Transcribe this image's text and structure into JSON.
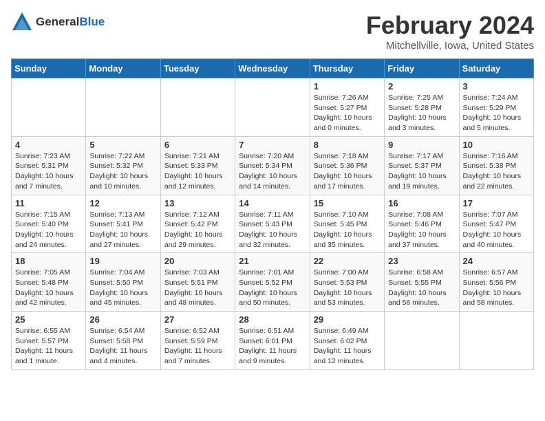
{
  "header": {
    "logo_general": "General",
    "logo_blue": "Blue",
    "month_year": "February 2024",
    "location": "Mitchellville, Iowa, United States"
  },
  "weekdays": [
    "Sunday",
    "Monday",
    "Tuesday",
    "Wednesday",
    "Thursday",
    "Friday",
    "Saturday"
  ],
  "weeks": [
    [
      {
        "day": "",
        "info": ""
      },
      {
        "day": "",
        "info": ""
      },
      {
        "day": "",
        "info": ""
      },
      {
        "day": "",
        "info": ""
      },
      {
        "day": "1",
        "info": "Sunrise: 7:26 AM\nSunset: 5:27 PM\nDaylight: 10 hours\nand 0 minutes."
      },
      {
        "day": "2",
        "info": "Sunrise: 7:25 AM\nSunset: 5:28 PM\nDaylight: 10 hours\nand 3 minutes."
      },
      {
        "day": "3",
        "info": "Sunrise: 7:24 AM\nSunset: 5:29 PM\nDaylight: 10 hours\nand 5 minutes."
      }
    ],
    [
      {
        "day": "4",
        "info": "Sunrise: 7:23 AM\nSunset: 5:31 PM\nDaylight: 10 hours\nand 7 minutes."
      },
      {
        "day": "5",
        "info": "Sunrise: 7:22 AM\nSunset: 5:32 PM\nDaylight: 10 hours\nand 10 minutes."
      },
      {
        "day": "6",
        "info": "Sunrise: 7:21 AM\nSunset: 5:33 PM\nDaylight: 10 hours\nand 12 minutes."
      },
      {
        "day": "7",
        "info": "Sunrise: 7:20 AM\nSunset: 5:34 PM\nDaylight: 10 hours\nand 14 minutes."
      },
      {
        "day": "8",
        "info": "Sunrise: 7:18 AM\nSunset: 5:36 PM\nDaylight: 10 hours\nand 17 minutes."
      },
      {
        "day": "9",
        "info": "Sunrise: 7:17 AM\nSunset: 5:37 PM\nDaylight: 10 hours\nand 19 minutes."
      },
      {
        "day": "10",
        "info": "Sunrise: 7:16 AM\nSunset: 5:38 PM\nDaylight: 10 hours\nand 22 minutes."
      }
    ],
    [
      {
        "day": "11",
        "info": "Sunrise: 7:15 AM\nSunset: 5:40 PM\nDaylight: 10 hours\nand 24 minutes."
      },
      {
        "day": "12",
        "info": "Sunrise: 7:13 AM\nSunset: 5:41 PM\nDaylight: 10 hours\nand 27 minutes."
      },
      {
        "day": "13",
        "info": "Sunrise: 7:12 AM\nSunset: 5:42 PM\nDaylight: 10 hours\nand 29 minutes."
      },
      {
        "day": "14",
        "info": "Sunrise: 7:11 AM\nSunset: 5:43 PM\nDaylight: 10 hours\nand 32 minutes."
      },
      {
        "day": "15",
        "info": "Sunrise: 7:10 AM\nSunset: 5:45 PM\nDaylight: 10 hours\nand 35 minutes."
      },
      {
        "day": "16",
        "info": "Sunrise: 7:08 AM\nSunset: 5:46 PM\nDaylight: 10 hours\nand 37 minutes."
      },
      {
        "day": "17",
        "info": "Sunrise: 7:07 AM\nSunset: 5:47 PM\nDaylight: 10 hours\nand 40 minutes."
      }
    ],
    [
      {
        "day": "18",
        "info": "Sunrise: 7:05 AM\nSunset: 5:48 PM\nDaylight: 10 hours\nand 42 minutes."
      },
      {
        "day": "19",
        "info": "Sunrise: 7:04 AM\nSunset: 5:50 PM\nDaylight: 10 hours\nand 45 minutes."
      },
      {
        "day": "20",
        "info": "Sunrise: 7:03 AM\nSunset: 5:51 PM\nDaylight: 10 hours\nand 48 minutes."
      },
      {
        "day": "21",
        "info": "Sunrise: 7:01 AM\nSunset: 5:52 PM\nDaylight: 10 hours\nand 50 minutes."
      },
      {
        "day": "22",
        "info": "Sunrise: 7:00 AM\nSunset: 5:53 PM\nDaylight: 10 hours\nand 53 minutes."
      },
      {
        "day": "23",
        "info": "Sunrise: 6:58 AM\nSunset: 5:55 PM\nDaylight: 10 hours\nand 56 minutes."
      },
      {
        "day": "24",
        "info": "Sunrise: 6:57 AM\nSunset: 5:56 PM\nDaylight: 10 hours\nand 58 minutes."
      }
    ],
    [
      {
        "day": "25",
        "info": "Sunrise: 6:55 AM\nSunset: 5:57 PM\nDaylight: 11 hours\nand 1 minute."
      },
      {
        "day": "26",
        "info": "Sunrise: 6:54 AM\nSunset: 5:58 PM\nDaylight: 11 hours\nand 4 minutes."
      },
      {
        "day": "27",
        "info": "Sunrise: 6:52 AM\nSunset: 5:59 PM\nDaylight: 11 hours\nand 7 minutes."
      },
      {
        "day": "28",
        "info": "Sunrise: 6:51 AM\nSunset: 6:01 PM\nDaylight: 11 hours\nand 9 minutes."
      },
      {
        "day": "29",
        "info": "Sunrise: 6:49 AM\nSunset: 6:02 PM\nDaylight: 11 hours\nand 12 minutes."
      },
      {
        "day": "",
        "info": ""
      },
      {
        "day": "",
        "info": ""
      }
    ]
  ]
}
